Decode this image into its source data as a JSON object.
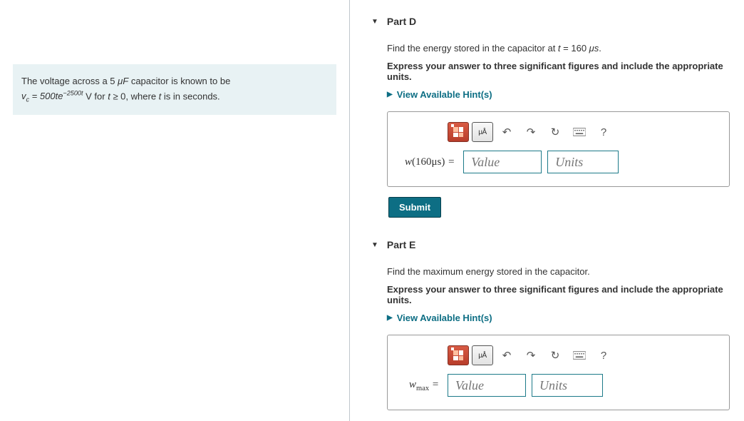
{
  "problem": {
    "line1_pre": "The voltage across a 5 ",
    "cap_unit": "μF",
    "line1_post": " capacitor is known to be",
    "eq_lhs": "v",
    "eq_sub": "c",
    "eq_mid": " = 500",
    "eq_t": "t",
    "eq_e": "e",
    "eq_exp": "−2500t",
    "eq_unit": " V  for  ",
    "eq_cond_t": "t",
    "eq_cond": " ≥ 0, where ",
    "eq_cond_t2": "t",
    "eq_tail": " is in seconds."
  },
  "partD": {
    "title": "Part D",
    "q_pre": "Find the energy stored in the capacitor at ",
    "q_t": "t",
    "q_eq": " = 160 ",
    "q_unit": "μs",
    "q_post": ".",
    "instr": "Express your answer to three significant figures and include the appropriate units.",
    "hints": "View Available Hint(s)",
    "var_pre": "w",
    "var_arg": "(160μs)",
    "var_eq": " = ",
    "value_ph": "Value",
    "units_ph": "Units",
    "submit": "Submit"
  },
  "partE": {
    "title": "Part E",
    "q": "Find the maximum energy stored in the capacitor.",
    "instr": "Express your answer to three significant figures and include the appropriate units.",
    "hints": "View Available Hint(s)",
    "var_pre": "w",
    "var_sub": "max",
    "var_eq": " = ",
    "value_ph": "Value",
    "units_ph": "Units"
  },
  "tb": {
    "mu_a": "μÅ",
    "undo": "↶",
    "redo": "↷",
    "reset": "↻",
    "help": "?"
  }
}
